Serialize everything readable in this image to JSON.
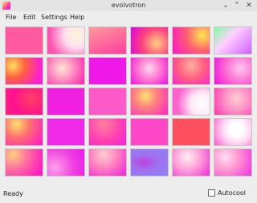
{
  "window": {
    "title": "evolvotron"
  },
  "menu": [
    "File",
    "Edit",
    "Settings",
    "Help"
  ],
  "status": {
    "text": "Ready"
  },
  "autocool": {
    "label": "Autocool",
    "checked": false
  },
  "icons": {
    "app": "evolvotron-app-icon",
    "min": "chevron-down-icon",
    "max": "chevron-up-icon",
    "close": "close-icon"
  }
}
